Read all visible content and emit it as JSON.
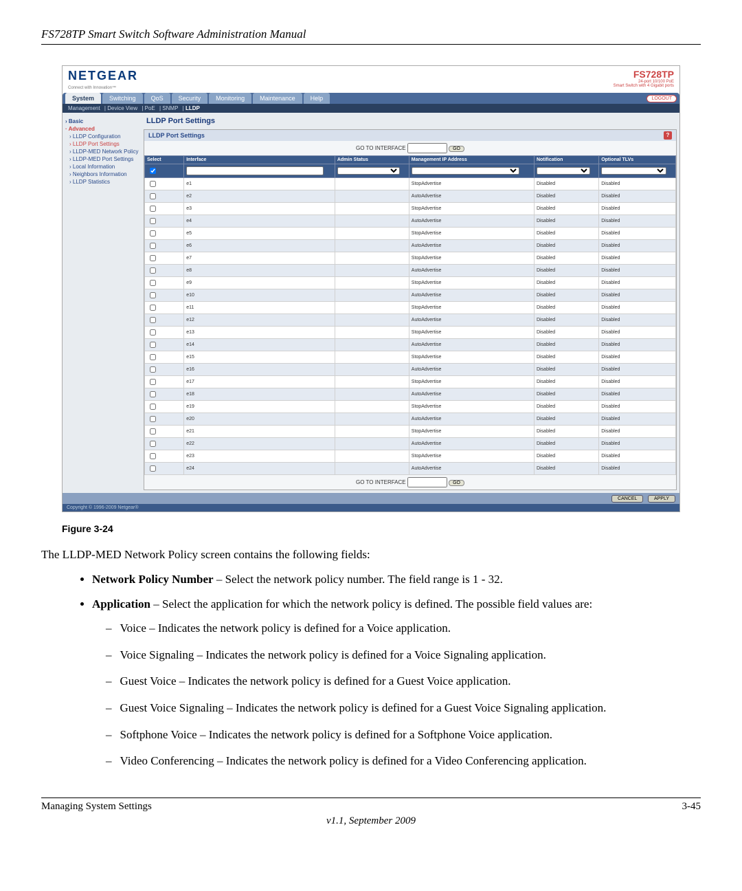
{
  "doc": {
    "header": "FS728TP Smart Switch Software Administration Manual",
    "figure_caption": "Figure 3-24",
    "intro": "The LLDP-MED Network Policy screen contains the following fields:",
    "fields": [
      {
        "term": "Network Policy Number",
        "desc": " – Select the network policy number. The field range is 1 - 32."
      },
      {
        "term": "Application",
        "desc": " – Select the application for which the network policy is defined. The possible field values are:",
        "subvalues": [
          "Voice – Indicates the network policy is defined for a Voice application.",
          "Voice Signaling – Indicates the network policy is defined for a Voice Signaling application.",
          "Guest Voice – Indicates the network policy is defined for a Guest Voice application.",
          "Guest Voice Signaling – Indicates the network policy is defined for a Guest Voice Signaling application.",
          "Softphone Voice – Indicates the network policy is defined for a Softphone Voice application.",
          "Video Conferencing – Indicates the network policy is defined for a Video Conferencing application."
        ]
      }
    ],
    "footer_left": "Managing System Settings",
    "footer_right": "3-45",
    "version": "v1.1, September 2009"
  },
  "app": {
    "brand": "NETGEAR",
    "brand_sub": "Connect with Innovation™",
    "model": "FS728TP",
    "model_sub1": "24-port 10/100 PoE",
    "model_sub2": "Smart Switch with 4 Gigabit ports",
    "logout": "LOGOUT",
    "tabs": [
      "System",
      "Switching",
      "QoS",
      "Security",
      "Monitoring",
      "Maintenance",
      "Help"
    ],
    "active_tab": "System",
    "subtabs": [
      "Management",
      "Device View",
      "PoE",
      "SNMP",
      "LLDP"
    ],
    "active_subtab": "LLDP",
    "sidebar": {
      "basic": "Basic",
      "advanced": "Advanced",
      "items": [
        "LLDP Configuration",
        "LLDP Port Settings",
        "LLDP-MED Network Policy",
        "LLDP-MED Port Settings",
        "Local Information",
        "Neighbors Information",
        "LLDP Statistics"
      ],
      "selected": "LLDP Port Settings"
    },
    "panel": {
      "title": "LLDP Port Settings",
      "inner_title": "LLDP Port Settings",
      "goto_label": "GO TO INTERFACE",
      "go_btn": "GO",
      "columns": [
        "Select",
        "Interface",
        "Admin Status",
        "Management IP Address",
        "Notification",
        "Optional TLVs"
      ],
      "rows": [
        {
          "iface": "e1",
          "admin": "",
          "mgmt": "StopAdvertise",
          "notif": "Disabled",
          "tlv": "Disabled"
        },
        {
          "iface": "e2",
          "admin": "",
          "mgmt": "AutoAdvertise",
          "notif": "Disabled",
          "tlv": "Disabled"
        },
        {
          "iface": "e3",
          "admin": "",
          "mgmt": "StopAdvertise",
          "notif": "Disabled",
          "tlv": "Disabled"
        },
        {
          "iface": "e4",
          "admin": "",
          "mgmt": "AutoAdvertise",
          "notif": "Disabled",
          "tlv": "Disabled"
        },
        {
          "iface": "e5",
          "admin": "",
          "mgmt": "StopAdvertise",
          "notif": "Disabled",
          "tlv": "Disabled"
        },
        {
          "iface": "e6",
          "admin": "",
          "mgmt": "AutoAdvertise",
          "notif": "Disabled",
          "tlv": "Disabled"
        },
        {
          "iface": "e7",
          "admin": "",
          "mgmt": "StopAdvertise",
          "notif": "Disabled",
          "tlv": "Disabled"
        },
        {
          "iface": "e8",
          "admin": "",
          "mgmt": "AutoAdvertise",
          "notif": "Disabled",
          "tlv": "Disabled"
        },
        {
          "iface": "e9",
          "admin": "",
          "mgmt": "StopAdvertise",
          "notif": "Disabled",
          "tlv": "Disabled"
        },
        {
          "iface": "e10",
          "admin": "",
          "mgmt": "AutoAdvertise",
          "notif": "Disabled",
          "tlv": "Disabled"
        },
        {
          "iface": "e11",
          "admin": "",
          "mgmt": "StopAdvertise",
          "notif": "Disabled",
          "tlv": "Disabled"
        },
        {
          "iface": "e12",
          "admin": "",
          "mgmt": "AutoAdvertise",
          "notif": "Disabled",
          "tlv": "Disabled"
        },
        {
          "iface": "e13",
          "admin": "",
          "mgmt": "StopAdvertise",
          "notif": "Disabled",
          "tlv": "Disabled"
        },
        {
          "iface": "e14",
          "admin": "",
          "mgmt": "AutoAdvertise",
          "notif": "Disabled",
          "tlv": "Disabled"
        },
        {
          "iface": "e15",
          "admin": "",
          "mgmt": "StopAdvertise",
          "notif": "Disabled",
          "tlv": "Disabled"
        },
        {
          "iface": "e16",
          "admin": "",
          "mgmt": "AutoAdvertise",
          "notif": "Disabled",
          "tlv": "Disabled"
        },
        {
          "iface": "e17",
          "admin": "",
          "mgmt": "StopAdvertise",
          "notif": "Disabled",
          "tlv": "Disabled"
        },
        {
          "iface": "e18",
          "admin": "",
          "mgmt": "AutoAdvertise",
          "notif": "Disabled",
          "tlv": "Disabled"
        },
        {
          "iface": "e19",
          "admin": "",
          "mgmt": "StopAdvertise",
          "notif": "Disabled",
          "tlv": "Disabled"
        },
        {
          "iface": "e20",
          "admin": "",
          "mgmt": "AutoAdvertise",
          "notif": "Disabled",
          "tlv": "Disabled"
        },
        {
          "iface": "e21",
          "admin": "",
          "mgmt": "StopAdvertise",
          "notif": "Disabled",
          "tlv": "Disabled"
        },
        {
          "iface": "e22",
          "admin": "",
          "mgmt": "AutoAdvertise",
          "notif": "Disabled",
          "tlv": "Disabled"
        },
        {
          "iface": "e23",
          "admin": "",
          "mgmt": "StopAdvertise",
          "notif": "Disabled",
          "tlv": "Disabled"
        },
        {
          "iface": "e24",
          "admin": "",
          "mgmt": "AutoAdvertise",
          "notif": "Disabled",
          "tlv": "Disabled"
        }
      ],
      "cancel": "CANCEL",
      "apply": "APPLY"
    },
    "copyright": "Copyright © 1996-2009 Netgear®"
  }
}
